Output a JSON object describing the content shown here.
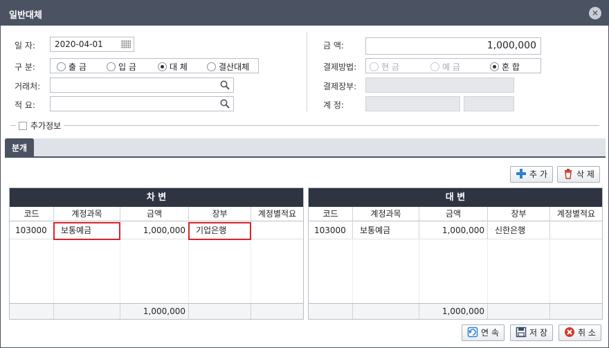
{
  "window": {
    "title": "일반대체"
  },
  "form": {
    "date_label": "일 자:",
    "date_value": "2020-04-01",
    "type_label": "구 분:",
    "type_options": [
      "출 금",
      "입 금",
      "대 체",
      "결산대체"
    ],
    "type_selected": 2,
    "client_label": "거래처:",
    "client_value": "",
    "memo_label": "적 요:",
    "memo_value": "",
    "amount_label": "금 액:",
    "amount_value": "1,000,000",
    "payment_label": "결제방법:",
    "payment_options": [
      "현 금",
      "예 금",
      "혼 합"
    ],
    "payment_selected": 2,
    "ledger_label": "결제장부:",
    "account_label": "계 정:",
    "extra_info_label": "추가정보"
  },
  "tabs": [
    {
      "label": "분개"
    }
  ],
  "toolbar": {
    "add_label": "추 가",
    "delete_label": "삭 제"
  },
  "debit": {
    "title": "차 변",
    "columns": [
      "코드",
      "계정과목",
      "금액",
      "장부",
      "계정별적요"
    ],
    "rows": [
      {
        "code": "103000",
        "account": "보통예금",
        "amount": "1,000,000",
        "ledger": "기업은행",
        "memo": ""
      }
    ],
    "total": "1,000,000"
  },
  "credit": {
    "title": "대 변",
    "columns": [
      "코드",
      "계정과목",
      "금액",
      "장부",
      "계정별적요"
    ],
    "rows": [
      {
        "code": "103000",
        "account": "보통예금",
        "amount": "1,000,000",
        "ledger": "신한은행",
        "memo": ""
      }
    ],
    "total": "1,000,000"
  },
  "footer": {
    "continue_label": "연 속",
    "save_label": "저 장",
    "cancel_label": "취 소"
  },
  "colors": {
    "titlebar": "#4b5262",
    "grid_header": "#2f3443",
    "highlight": "#d8232a",
    "add_icon": "#2f7fd1",
    "delete_icon": "#c0392b",
    "cancel_icon": "#d23a2a"
  }
}
